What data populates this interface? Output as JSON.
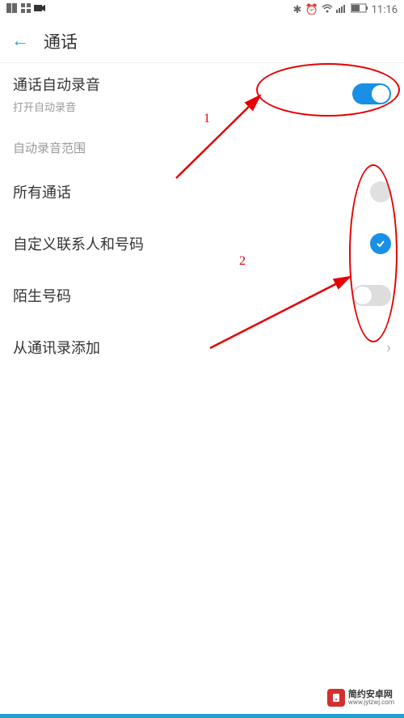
{
  "status_bar": {
    "time": "11:16"
  },
  "header": {
    "title": "通话"
  },
  "auto_record": {
    "title": "通话自动录音",
    "subtitle": "打开自动录音",
    "enabled": true
  },
  "section_header": "自动录音范围",
  "options": {
    "all_calls": {
      "label": "所有通话",
      "selected": false
    },
    "custom_contacts": {
      "label": "自定义联系人和号码",
      "selected": true
    },
    "unknown_numbers": {
      "label": "陌生号码",
      "enabled": false
    },
    "add_from_contacts": {
      "label": "从通讯录添加"
    }
  },
  "annotations": {
    "num1": "1",
    "num2": "2"
  },
  "watermark": {
    "title": "简约安卓网",
    "url": "www.jylzwj.com"
  }
}
